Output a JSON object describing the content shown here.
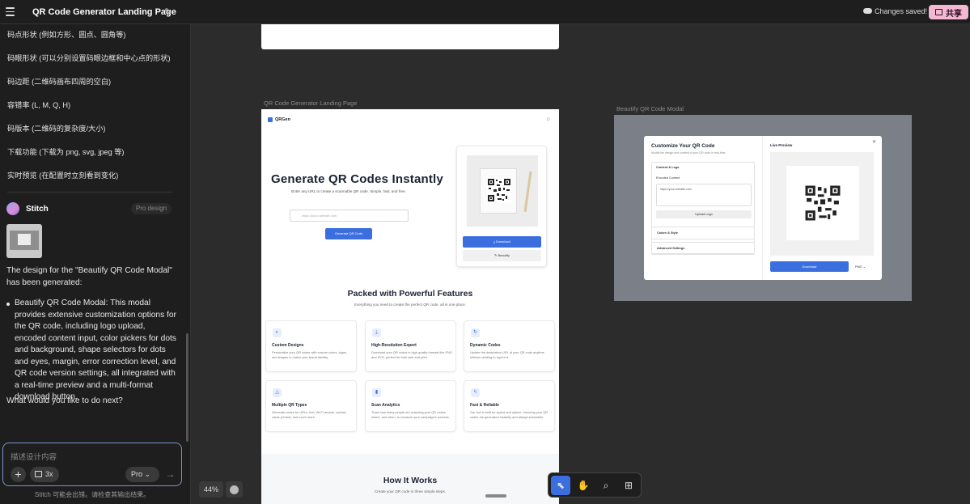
{
  "app": {
    "title": "QR Code Generator Landing Page",
    "saved_status": "Changes saved!",
    "share_label": "共享"
  },
  "sidebar": {
    "spec_items": [
      "码点形状 (例如方形、圆点、圆角等)",
      "码眼形状 (可以分别设置码眼边框和中心点的形状)",
      "码边距 (二维码画布四周的空白)",
      "容错率 (L, M, Q, H)",
      "码版本 (二维码的复杂度/大小)",
      "下载功能 (下载为 png, svg, jpeg 等)",
      "实时预览 (在配置时立刻看到变化)"
    ],
    "agent_name": "Stitch",
    "agent_badge": "Pro design",
    "message_intro": "The design for the \"Beautify QR Code Modal\" has been generated:",
    "message_bullet": "Beautify QR Code Modal: This modal provides extensive customization options for the QR code, including logo upload, encoded content input, color pickers for dots and background, shape selectors for dots and eyes, margin, error correction level, and QR code version settings, all integrated with a real-time preview and a multi-format download button.",
    "message_question": "What would you like to do next?",
    "input_placeholder": "描述设计内容",
    "count_label": "3x",
    "model_label": "Pro",
    "disclaimer": "Stitch 可能会出错。请检查其输出结果。"
  },
  "canvas": {
    "zoom_label": "44%",
    "frames": [
      {
        "label": "QR Code Generator Landing Page"
      },
      {
        "label": "Beautify QR Code Modal"
      }
    ],
    "tools": [
      "pointer-tool",
      "hand-tool",
      "search-tool",
      "add-screen-tool"
    ]
  },
  "landing": {
    "brand": "QRGen",
    "hero_title": "Generate QR Codes Instantly",
    "hero_subtitle": "Enter any URL to create a scannable QR code. Simple, fast, and free.",
    "url_placeholder": "https://your-website.com",
    "generate_label": "Generate QR Code",
    "download_label": "Download",
    "beautify_label": "Beautify",
    "features_title": "Packed with Powerful Features",
    "features_subtitle": "Everything you need to create the perfect QR code, all in one place.",
    "features": [
      {
        "title": "Custom Designs",
        "desc": "Personalize your QR codes with custom colors, logos, and shapes to match your brand identity."
      },
      {
        "title": "High-Resolution Export",
        "desc": "Download your QR codes in high-quality formats like PNG and SVG, perfect for both web and print."
      },
      {
        "title": "Dynamic Codes",
        "desc": "Update the destination URL of your QR code anytime without needing to reprint it."
      },
      {
        "title": "Multiple QR Types",
        "desc": "Generate codes for URLs, text, Wi-Fi access, contact cards (vCard), and much more."
      },
      {
        "title": "Scan Analytics",
        "desc": "Track how many people are scanning your QR codes, where, and when, to measure your campaign's success."
      },
      {
        "title": "Fast & Reliable",
        "desc": "Our tool is built for speed and uptime, ensuring your QR codes are generated instantly and always scannable."
      }
    ],
    "how_title": "How It Works",
    "how_subtitle": "Create your QR code in three simple steps."
  },
  "modal": {
    "title": "Customize Your QR Code",
    "subtitle": "Modify the design and content of your QR code in real-time.",
    "section_content": "Content & Logo",
    "encoded_label": "Encoded Content",
    "encoded_value": "https://your-website.com",
    "upload_label": "Upload Logo",
    "section_colors": "Colors & Style",
    "section_advanced": "Advanced Settings",
    "live_preview": "Live Preview",
    "download_label": "Download",
    "format_value": "PNG"
  }
}
